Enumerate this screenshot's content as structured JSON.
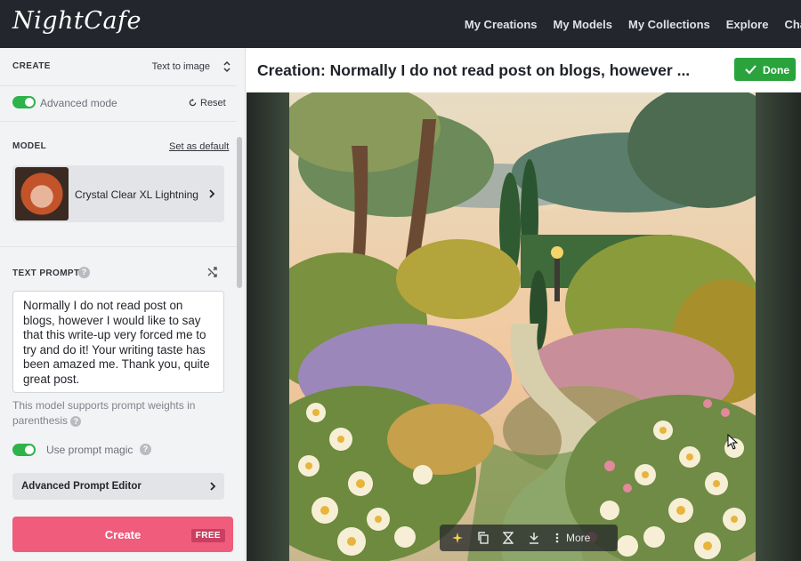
{
  "app": {
    "logo": "NightCafe"
  },
  "nav": [
    "My Creations",
    "My Models",
    "My Collections",
    "Explore",
    "Cha"
  ],
  "create": {
    "label": "CREATE",
    "mode": "Text to image"
  },
  "advanced": {
    "label": "Advanced mode",
    "enabled": true,
    "reset_label": "Reset"
  },
  "model": {
    "label": "MODEL",
    "set_default": "Set as default",
    "name": "Crystal Clear XL Lightning"
  },
  "text_prompt": {
    "label": "TEXT PROMPT",
    "value": "Normally I do not read post on blogs, however I would like to say that this write-up very forced me to try and do it! Your writing taste has been amazed me. Thank you, quite great post.",
    "note": "This model supports prompt weights in parenthesis"
  },
  "prompt_magic": {
    "label": "Use prompt magic",
    "enabled": true
  },
  "advanced_editor": {
    "label": "Advanced Prompt Editor"
  },
  "create_button": {
    "label": "Create",
    "badge": "FREE"
  },
  "header": {
    "title": "Creation: Normally I do not read post on blogs, however ...",
    "done_label": "Done"
  },
  "image_toolbar": {
    "more_label": "More"
  },
  "colors": {
    "accent_green": "#2aa33d",
    "create_pink": "#ef5c7c",
    "topbar": "#23262d"
  }
}
